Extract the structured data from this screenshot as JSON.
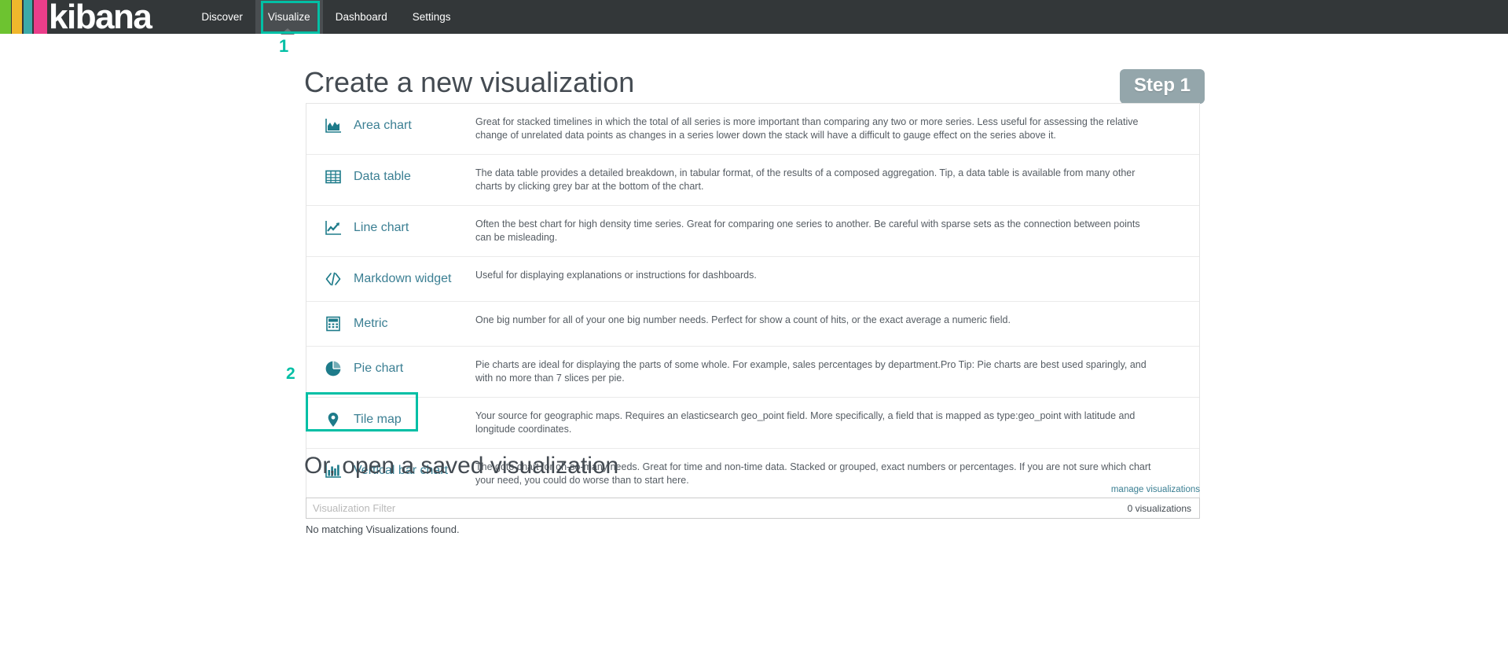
{
  "app": {
    "brand": "kibana",
    "accent_teal": "#00bfa5",
    "navbar_bg": "#333739",
    "link_color": "#3b7f93",
    "icon_color": "#1e7b8a"
  },
  "navbar": {
    "tabs": [
      {
        "label": "Discover",
        "active": false,
        "icon": "compass-icon"
      },
      {
        "label": "Visualize",
        "active": true,
        "icon": "bar-chart-icon"
      },
      {
        "label": "Dashboard",
        "active": false,
        "icon": "dashboard-icon"
      },
      {
        "label": "Settings",
        "active": false,
        "icon": "gear-icon"
      }
    ]
  },
  "annotations": {
    "marker_one": "1",
    "marker_two": "2"
  },
  "main": {
    "page_title": "Create a new visualization",
    "step_badge": "Step 1",
    "vis_types": [
      {
        "name": "Area chart",
        "icon": "area-chart-icon",
        "description": "Great for stacked timelines in which the total of all series is more important than comparing any two or more series. Less useful for assessing the relative change of unrelated data points as changes in a series lower down the stack will have a difficult to gauge effect on the series above it."
      },
      {
        "name": "Data table",
        "icon": "table-icon",
        "description": "The data table provides a detailed breakdown, in tabular format, of the results of a composed aggregation. Tip, a data table is available from many other charts by clicking grey bar at the bottom of the chart."
      },
      {
        "name": "Line chart",
        "icon": "line-chart-icon",
        "description": "Often the best chart for high density time series. Great for comparing one series to another. Be careful with sparse sets as the connection between points can be misleading."
      },
      {
        "name": "Markdown widget",
        "icon": "code-brackets-icon",
        "description": "Useful for displaying explanations or instructions for dashboards."
      },
      {
        "name": "Metric",
        "icon": "calculator-icon",
        "description": "One big number for all of your one big number needs. Perfect for show a count of hits, or the exact average a numeric field."
      },
      {
        "name": "Pie chart",
        "icon": "pie-chart-icon",
        "description": "Pie charts are ideal for displaying the parts of some whole. For example, sales percentages by department.Pro Tip: Pie charts are best used sparingly, and with no more than 7 slices per pie."
      },
      {
        "name": "Tile map",
        "icon": "map-pin-icon",
        "description": "Your source for geographic maps. Requires an elasticsearch geo_point field. More specifically, a field that is mapped as type:geo_point with latitude and longitude coordinates."
      },
      {
        "name": "Vertical bar chart",
        "icon": "bar-chart-icon",
        "description": "The goto chart for oh-so-many needs. Great for time and non-time data. Stacked or grouped, exact numbers or percentages. If you are not sure which chart your need, you could do worse than to start here."
      }
    ]
  },
  "saved": {
    "title": "Or, open a saved visualization",
    "manage_link": "manage visualizations",
    "filter_placeholder": "Visualization Filter",
    "filter_value": "",
    "count_label": "0 visualizations",
    "empty_message": "No matching Visualizations found."
  }
}
